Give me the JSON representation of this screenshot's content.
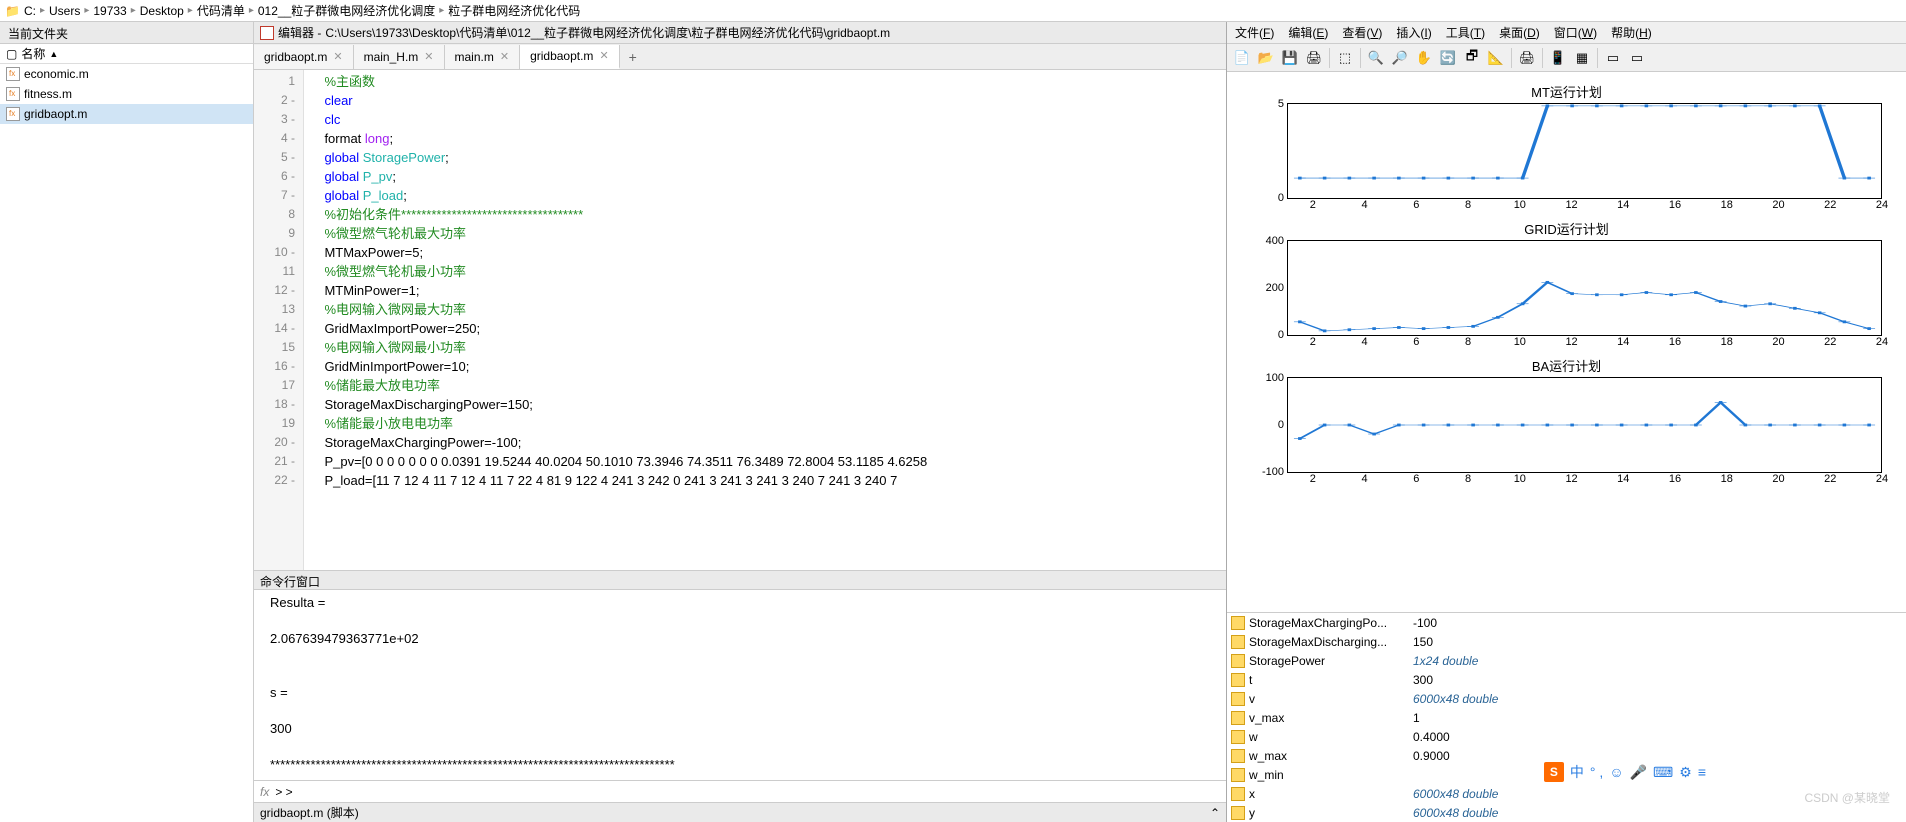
{
  "breadcrumb": [
    "C:",
    "Users",
    "19733",
    "Desktop",
    "代码清单",
    "012__粒子群微电网经济优化调度",
    "粒子群电网经济优化代码"
  ],
  "leftPanel": {
    "title": "当前文件夹",
    "colHeader": "名称",
    "files": [
      "economic.m",
      "fitness.m",
      "gridbaopt.m"
    ],
    "selected": 2
  },
  "statusBar": {
    "text": "gridbaopt.m  (脚本)"
  },
  "editor": {
    "titlePrefix": "编辑器 - ",
    "path": "C:\\Users\\19733\\Desktop\\代码清单\\012__粒子群微电网经济优化调度\\粒子群电网经济优化代码\\gridbaopt.m",
    "tabs": [
      "gridbaopt.m",
      "main_H.m",
      "main.m",
      "gridbaopt.m"
    ],
    "activeTab": 3
  },
  "codeLines": [
    {
      "n": "1",
      "t": "comment",
      "txt": "%主函数"
    },
    {
      "n": "2 -",
      "t": "kw",
      "txt": "clear"
    },
    {
      "n": "3 -",
      "t": "kw",
      "txt": "clc"
    },
    {
      "n": "4 -",
      "t": "mix",
      "pre": "format ",
      "kw": "long",
      "post": ";"
    },
    {
      "n": "5 -",
      "t": "glb",
      "pre": "global ",
      "g": "StoragePower",
      "post": ";"
    },
    {
      "n": "6 -",
      "t": "glb",
      "pre": "global ",
      "g": "P_pv",
      "post": ";"
    },
    {
      "n": "7 -",
      "t": "glb",
      "pre": "global ",
      "g": "P_load",
      "post": ";"
    },
    {
      "n": "8",
      "t": "comment",
      "txt": "%初始化条件************************************"
    },
    {
      "n": "9",
      "t": "comment",
      "txt": "%微型燃气轮机最大功率"
    },
    {
      "n": "10 -",
      "t": "plain",
      "txt": "MTMaxPower=5;"
    },
    {
      "n": "11",
      "t": "comment",
      "txt": "%微型燃气轮机最小功率"
    },
    {
      "n": "12 -",
      "t": "plain",
      "txt": "MTMinPower=1;"
    },
    {
      "n": "13",
      "t": "comment",
      "txt": "%电网输入微网最大功率"
    },
    {
      "n": "14 -",
      "t": "plain",
      "txt": "GridMaxImportPower=250;"
    },
    {
      "n": "15",
      "t": "comment",
      "txt": "%电网输入微网最小功率"
    },
    {
      "n": "16 -",
      "t": "plain",
      "txt": "GridMinImportPower=10;"
    },
    {
      "n": "17",
      "t": "comment",
      "txt": "%储能最大放电功率"
    },
    {
      "n": "18 -",
      "t": "plain",
      "txt": "StorageMaxDischargingPower=150;"
    },
    {
      "n": "19",
      "t": "comment",
      "txt": "%储能最小放电电功率"
    },
    {
      "n": "20 -",
      "t": "plain",
      "txt": "StorageMaxChargingPower=-100;"
    },
    {
      "n": "21 -",
      "t": "plain",
      "txt": "P_pv=[0 0 0 0 0 0 0 0.0391 19.5244 40.0204 50.1010 73.3946 74.3511 76.3489 72.8004 53.1185 4.6258"
    },
    {
      "n": "22 -",
      "t": "plain",
      "txt": "P_load=[11 7 12 4 11 7 12 4 11 7 22 4 81 9 122 4 241 3 242 0 241 3 241 3 241 3 240 7 241 3 240 7"
    }
  ],
  "cmdWindow": {
    "title": "命令行窗口",
    "lines": [
      "Resulta =",
      "",
      "   2.067639479363771e+02",
      "",
      "",
      "s =",
      "",
      "   300",
      "",
      "********************************************************************************"
    ],
    "prompt": "> >"
  },
  "figure": {
    "menus": [
      {
        "l": "文件",
        "u": "F"
      },
      {
        "l": "编辑",
        "u": "E"
      },
      {
        "l": "查看",
        "u": "V"
      },
      {
        "l": "插入",
        "u": "I"
      },
      {
        "l": "工具",
        "u": "T"
      },
      {
        "l": "桌面",
        "u": "D"
      },
      {
        "l": "窗口",
        "u": "W"
      },
      {
        "l": "帮助",
        "u": "H"
      }
    ],
    "tools": [
      "📄",
      "📂",
      "💾",
      "🖨",
      "|",
      "⬚",
      "|",
      "🔍",
      "🔎",
      "✋",
      "🔄",
      "🗗",
      "📐",
      "|",
      "🖨",
      "|",
      "📱",
      "▦",
      "|",
      "▭",
      "▭"
    ]
  },
  "chart_data": [
    {
      "type": "line",
      "title": "MT运行计划",
      "x": [
        1,
        2,
        3,
        4,
        5,
        6,
        7,
        8,
        9,
        10,
        11,
        12,
        13,
        14,
        15,
        16,
        17,
        18,
        19,
        20,
        21,
        22,
        23,
        24
      ],
      "values": [
        1,
        1,
        1,
        1,
        1,
        1,
        1,
        1,
        1,
        1,
        5,
        5,
        5,
        5,
        5,
        5,
        5,
        5,
        5,
        5,
        5,
        5,
        1,
        1
      ],
      "xticks": [
        2,
        4,
        6,
        8,
        10,
        12,
        14,
        16,
        18,
        20,
        22,
        24
      ],
      "yticks": [
        0,
        5
      ],
      "ylim": [
        0,
        5
      ]
    },
    {
      "type": "line",
      "title": "GRID运行计划",
      "x": [
        1,
        2,
        3,
        4,
        5,
        6,
        7,
        8,
        9,
        10,
        11,
        12,
        13,
        14,
        15,
        16,
        17,
        18,
        19,
        20,
        21,
        22,
        23,
        24
      ],
      "values": [
        50,
        10,
        15,
        20,
        25,
        20,
        25,
        30,
        70,
        130,
        225,
        175,
        170,
        170,
        180,
        170,
        180,
        140,
        120,
        130,
        110,
        90,
        50,
        20
      ],
      "xticks": [
        2,
        4,
        6,
        8,
        10,
        12,
        14,
        16,
        18,
        20,
        22,
        24
      ],
      "yticks": [
        0,
        200,
        400
      ],
      "ylim": [
        0,
        400
      ]
    },
    {
      "type": "line",
      "title": "BA运行计划",
      "x": [
        1,
        2,
        3,
        4,
        5,
        6,
        7,
        8,
        9,
        10,
        11,
        12,
        13,
        14,
        15,
        16,
        17,
        18,
        19,
        20,
        21,
        22,
        23,
        24
      ],
      "values": [
        -30,
        0,
        0,
        -20,
        0,
        0,
        0,
        0,
        0,
        0,
        0,
        0,
        0,
        0,
        0,
        0,
        0,
        50,
        0,
        0,
        0,
        0,
        0,
        0
      ],
      "xticks": [
        2,
        4,
        6,
        8,
        10,
        12,
        14,
        16,
        18,
        20,
        22,
        24
      ],
      "yticks": [
        -100,
        0,
        100
      ],
      "ylim": [
        -100,
        100
      ]
    }
  ],
  "workspace": [
    {
      "name": "StorageMaxChargingPo...",
      "val": "-100",
      "it": false
    },
    {
      "name": "StorageMaxDischarging...",
      "val": "150",
      "it": false
    },
    {
      "name": "StoragePower",
      "val": "1x24 double",
      "it": true
    },
    {
      "name": "t",
      "val": "300",
      "it": false
    },
    {
      "name": "v",
      "val": "6000x48 double",
      "it": true
    },
    {
      "name": "v_max",
      "val": "1",
      "it": false
    },
    {
      "name": "w",
      "val": "0.4000",
      "it": false
    },
    {
      "name": "w_max",
      "val": "0.9000",
      "it": false
    },
    {
      "name": "w_min",
      "val": "",
      "it": false
    },
    {
      "name": "x",
      "val": "6000x48 double",
      "it": true
    },
    {
      "name": "y",
      "val": "6000x48 double",
      "it": true
    }
  ],
  "watermark": "CSDN @某晓堂",
  "sogou": {
    "label": "中"
  }
}
